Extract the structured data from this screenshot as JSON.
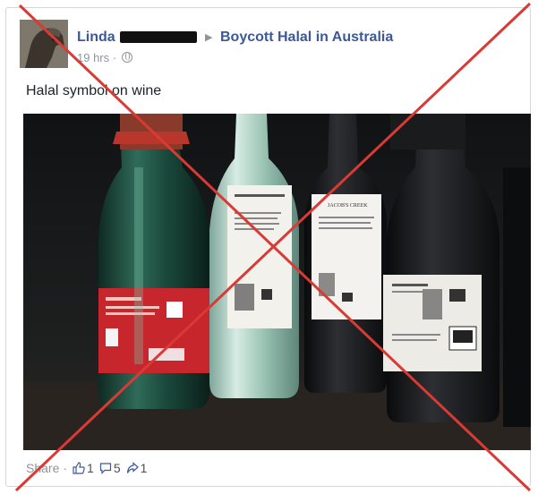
{
  "post": {
    "author": "Linda",
    "group": "Boycott Halal in Australia",
    "time": "19 hrs",
    "meta_separator": "·",
    "text": "Halal symbol on wine"
  },
  "footer": {
    "share_label": "Share",
    "separator": "·",
    "likes": "1",
    "comments": "5",
    "shares": "1"
  },
  "icons": {
    "globe": "globe-icon",
    "like": "thumbs-up-icon",
    "comment": "comment-bubble-icon",
    "share": "share-arrow-icon",
    "arrow": "triangle-right-icon"
  },
  "colors": {
    "link": "#3b5998",
    "meta": "#90949c",
    "cross": "#d93a34",
    "label_red": "#c8262d"
  },
  "photo": {
    "label_brand_1": "JACOB'S CREEK",
    "label_brand_2": "JACOB'S CREEK"
  }
}
